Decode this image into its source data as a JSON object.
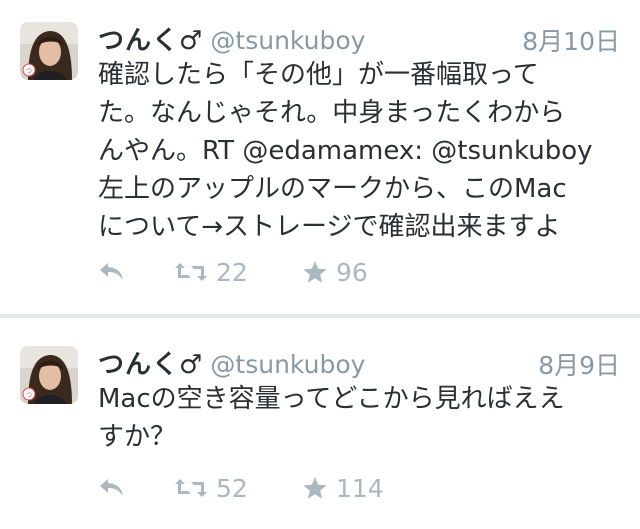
{
  "colors": {
    "background": "#e8e9ea",
    "card": "#ffffff",
    "text": "#292f33",
    "muted": "#8899a6",
    "action_icon": "#aab8c2"
  },
  "tweets": [
    {
      "display_name": "つんく♂",
      "handle": "@tsunkuboy",
      "timestamp": "8月10日",
      "text_lines": [
        "確認したら「その他」が一番幅取って",
        "た。なんじゃそれ。中身まったくわから",
        "んやん。RT @edamamex: @tsunkuboy",
        "左上のアップルのマークから、このMac",
        "について→ストレージで確認出来ますよ"
      ],
      "retweet_count": "22",
      "favorite_count": "96",
      "icons": {
        "reply": "reply-icon",
        "retweet": "retweet-icon",
        "favorite": "star-icon"
      }
    },
    {
      "display_name": "つんく♂",
      "handle": "@tsunkuboy",
      "timestamp": "8月9日",
      "text_lines": [
        "Macの空き容量ってどこから見ればええ",
        "すか？"
      ],
      "retweet_count": "52",
      "favorite_count": "114",
      "icons": {
        "reply": "reply-icon",
        "retweet": "retweet-icon",
        "favorite": "star-icon"
      }
    }
  ]
}
